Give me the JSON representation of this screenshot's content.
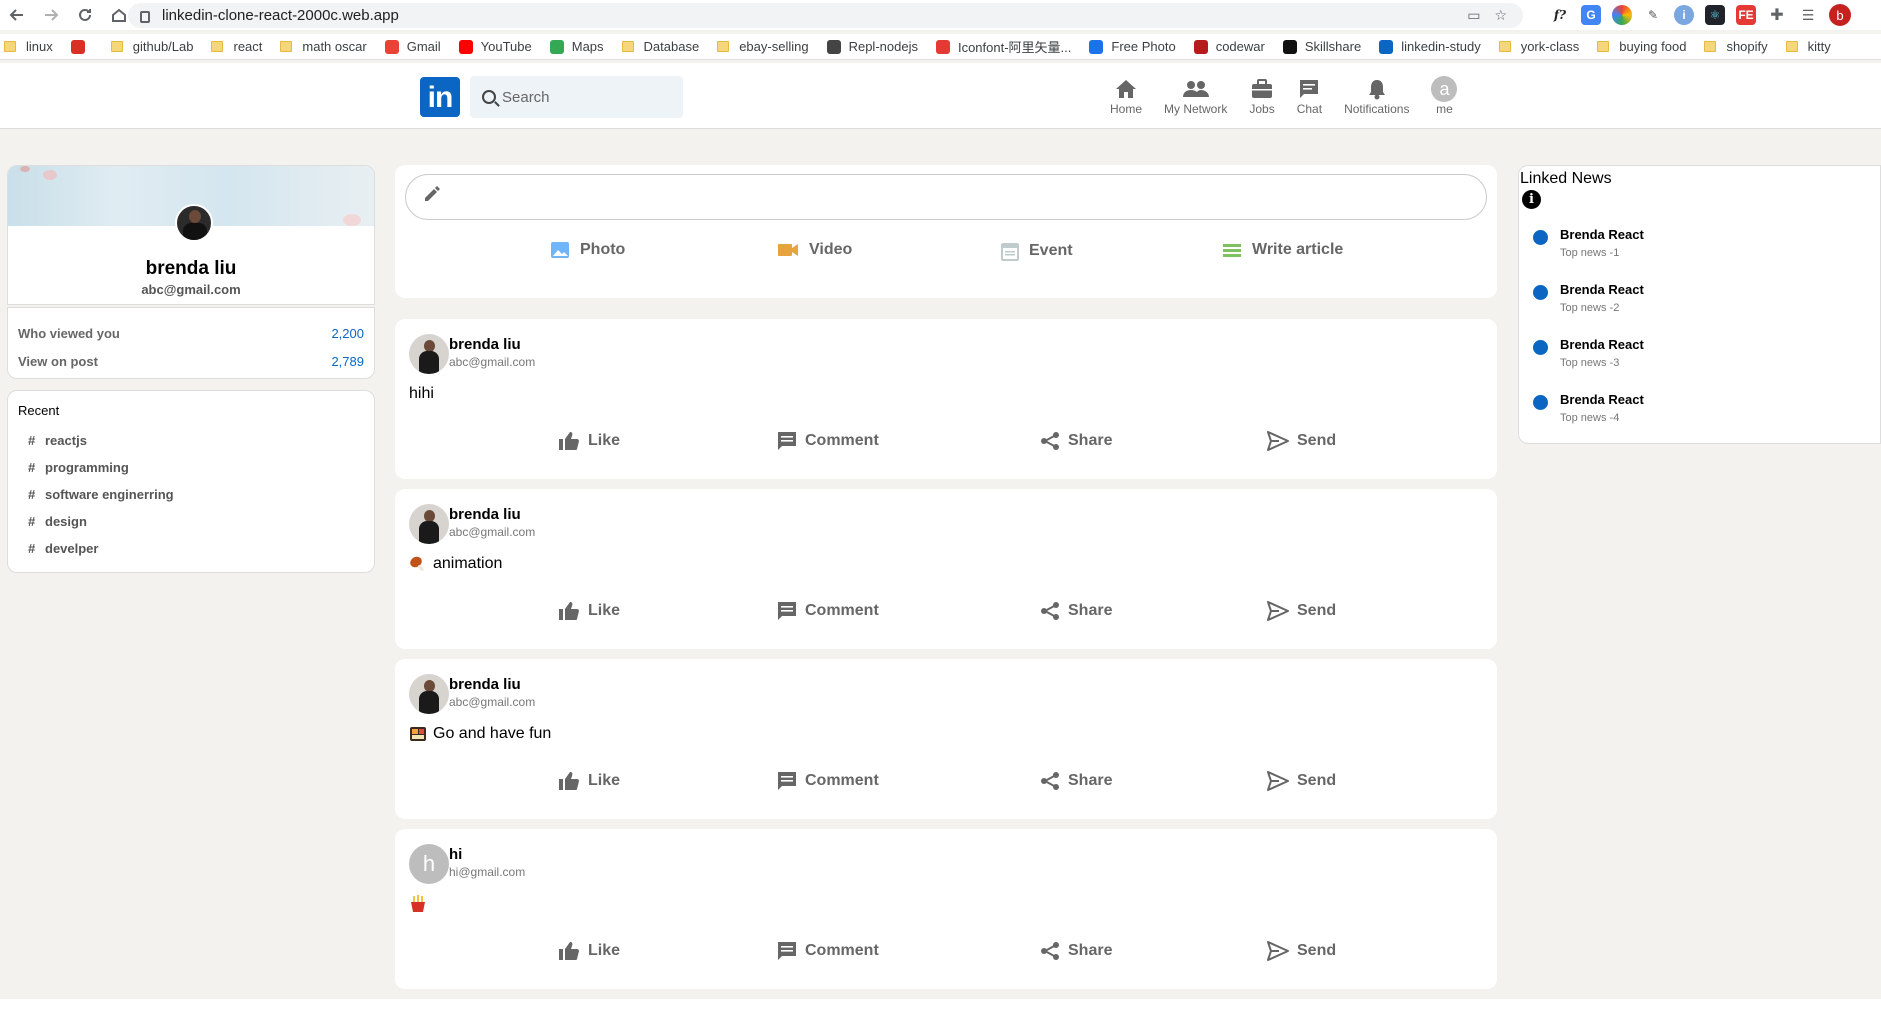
{
  "browser": {
    "url": "linkedin-clone-react-2000c.web.app",
    "profile_letter": "b",
    "bookmarks": [
      {
        "label": "linux",
        "type": "folder"
      },
      {
        "label": "",
        "type": "fav",
        "color": "#d93025"
      },
      {
        "label": "github/Lab",
        "type": "folder"
      },
      {
        "label": "react",
        "type": "folder"
      },
      {
        "label": "math oscar",
        "type": "folder"
      },
      {
        "label": "Gmail",
        "type": "fav",
        "color": "#ea4335"
      },
      {
        "label": "YouTube",
        "type": "fav",
        "color": "#ff0000"
      },
      {
        "label": "Maps",
        "type": "fav",
        "color": "#34a853"
      },
      {
        "label": "Database",
        "type": "folder"
      },
      {
        "label": "ebay-selling",
        "type": "folder"
      },
      {
        "label": "Repl-nodejs",
        "type": "fav",
        "color": "#444444"
      },
      {
        "label": "Iconfont-阿里矢量...",
        "type": "fav",
        "color": "#e53935"
      },
      {
        "label": "Free Photo",
        "type": "fav",
        "color": "#1a73e8"
      },
      {
        "label": "codewar",
        "type": "fav",
        "color": "#b71c1c"
      },
      {
        "label": "Skillshare",
        "type": "fav",
        "color": "#111111"
      },
      {
        "label": "linkedin-study",
        "type": "fav",
        "color": "#0a66c2"
      },
      {
        "label": "york-class",
        "type": "folder"
      },
      {
        "label": "buying food",
        "type": "folder"
      },
      {
        "label": "shopify",
        "type": "folder"
      },
      {
        "label": "kitty",
        "type": "folder"
      }
    ]
  },
  "header": {
    "logo": "in",
    "search_placeholder": "Search",
    "nav": [
      {
        "label": "Home",
        "icon": "home-icon"
      },
      {
        "label": "My Network",
        "icon": "network-icon"
      },
      {
        "label": "Jobs",
        "icon": "briefcase-icon"
      },
      {
        "label": "Chat",
        "icon": "chat-icon"
      },
      {
        "label": "Notifications",
        "icon": "bell-icon"
      },
      {
        "label": "me",
        "icon": "avatar-icon",
        "avatar_letter": "a"
      }
    ]
  },
  "sidebar": {
    "name": "brenda liu",
    "email": "abc@gmail.com",
    "stats": [
      {
        "label": "Who viewed you",
        "value": "2,200"
      },
      {
        "label": "View on post",
        "value": "2,789"
      }
    ],
    "recent_title": "Recent",
    "recent": [
      "reactjs",
      "programming",
      "software enginerring",
      "design",
      "develper"
    ]
  },
  "composer": {
    "options": [
      {
        "label": "Photo",
        "icon": "photo-icon",
        "color": "#70b5f9"
      },
      {
        "label": "Video",
        "icon": "video-icon",
        "color": "#e7a33e"
      },
      {
        "label": "Event",
        "icon": "calendar-icon",
        "color": "#c0cbcd"
      },
      {
        "label": "Write article",
        "icon": "article-icon",
        "color": "#7fc15e"
      }
    ]
  },
  "posts": [
    {
      "name": "brenda liu",
      "email": "abc@gmail.com",
      "message": "hihi",
      "emoji": ""
    },
    {
      "name": "brenda liu",
      "email": "abc@gmail.com",
      "message": "animation",
      "emoji": "drumstick"
    },
    {
      "name": "brenda liu",
      "email": "abc@gmail.com",
      "message": "Go and have fun",
      "emoji": "bento"
    },
    {
      "name": "hi",
      "email": "hi@gmail.com",
      "message": "",
      "emoji": "fries",
      "avatar_letter": "h"
    }
  ],
  "post_actions": [
    "Like",
    "Comment",
    "Share",
    "Send"
  ],
  "widgets": {
    "title": "Linked News",
    "items": [
      {
        "heading": "Brenda React",
        "subtitle": "Top news -1"
      },
      {
        "heading": "Brenda React",
        "subtitle": "Top news -2"
      },
      {
        "heading": "Brenda React",
        "subtitle": "Top news -3"
      },
      {
        "heading": "Brenda React",
        "subtitle": "Top news -4"
      }
    ]
  }
}
